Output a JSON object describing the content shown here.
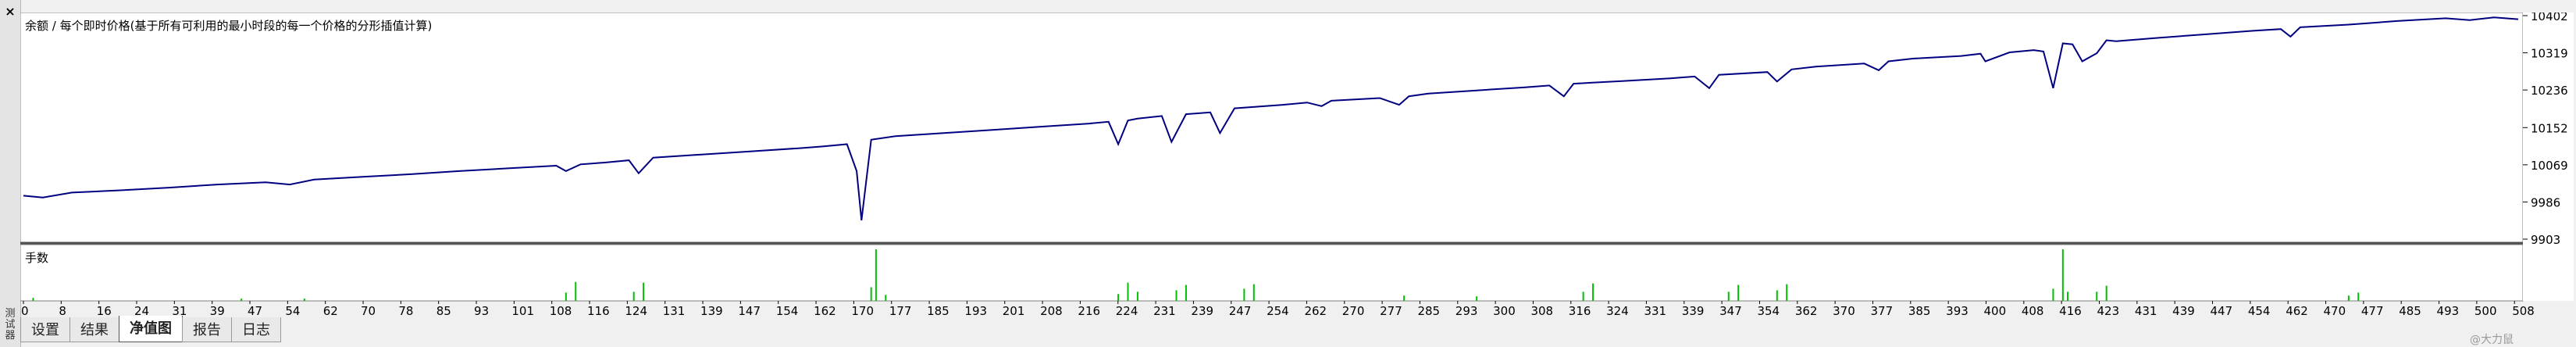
{
  "window": {
    "close_glyph": "×",
    "side_label": "测试器"
  },
  "tabs": [
    {
      "label": "设置",
      "active": false
    },
    {
      "label": "结果",
      "active": false
    },
    {
      "label": "净值图",
      "active": true
    },
    {
      "label": "报告",
      "active": false
    },
    {
      "label": "日志",
      "active": false
    }
  ],
  "watermark": "@大力鼠",
  "chart_data": [
    {
      "type": "line",
      "title": "余额 / 每个即时价格(基于所有可利用的最小时段的每一个价格的分形插值计算)",
      "ylim": [
        9903,
        10402
      ],
      "yticks": [
        "10402",
        "10319",
        "10236",
        "10152",
        "10069",
        "9986",
        "9903"
      ],
      "xlim": [
        0,
        515
      ],
      "series": [
        {
          "color": "#000080",
          "x": [
            0,
            4,
            10,
            20,
            30,
            40,
            50,
            55,
            60,
            70,
            80,
            90,
            100,
            110,
            112,
            115,
            120,
            125,
            127,
            130,
            140,
            150,
            160,
            165,
            170,
            172,
            173,
            175,
            180,
            190,
            200,
            210,
            220,
            224,
            226,
            228,
            230,
            235,
            237,
            240,
            245,
            247,
            250,
            260,
            265,
            268,
            270,
            280,
            284,
            286,
            290,
            300,
            310,
            315,
            318,
            320,
            330,
            340,
            345,
            348,
            350,
            360,
            362,
            365,
            370,
            380,
            383,
            385,
            390,
            400,
            404,
            405,
            410,
            415,
            417,
            419,
            421,
            423,
            425,
            428,
            430,
            432,
            440,
            450,
            460,
            466,
            468,
            470,
            480,
            490,
            500,
            505,
            510,
            515
          ],
          "y": [
            10000,
            9996,
            10007,
            10012,
            10018,
            10025,
            10030,
            10025,
            10036,
            10042,
            10048,
            10055,
            10061,
            10067,
            10055,
            10070,
            10074,
            10079,
            10050,
            10085,
            10092,
            10099,
            10106,
            10110,
            10115,
            10055,
            9945,
            10125,
            10133,
            10140,
            10147,
            10154,
            10161,
            10165,
            10115,
            10168,
            10172,
            10178,
            10120,
            10182,
            10186,
            10140,
            10195,
            10203,
            10208,
            10200,
            10212,
            10218,
            10203,
            10222,
            10228,
            10235,
            10242,
            10246,
            10222,
            10250,
            10256,
            10262,
            10266,
            10240,
            10270,
            10276,
            10255,
            10282,
            10288,
            10295,
            10280,
            10300,
            10306,
            10312,
            10317,
            10300,
            10320,
            10325,
            10322,
            10240,
            10340,
            10338,
            10300,
            10318,
            10347,
            10345,
            10352,
            10360,
            10368,
            10372,
            10355,
            10376,
            10382,
            10390,
            10396,
            10392,
            10398,
            10394
          ]
        }
      ]
    },
    {
      "type": "bar",
      "title": "手数",
      "xlim": [
        0,
        515
      ],
      "xticks": [
        "0",
        "8",
        "16",
        "24",
        "31",
        "39",
        "47",
        "54",
        "62",
        "70",
        "78",
        "85",
        "93",
        "101",
        "108",
        "116",
        "124",
        "131",
        "139",
        "147",
        "154",
        "162",
        "170",
        "177",
        "185",
        "193",
        "201",
        "208",
        "216",
        "224",
        "231",
        "239",
        "247",
        "254",
        "262",
        "270",
        "277",
        "285",
        "293",
        "300",
        "308",
        "316",
        "324",
        "331",
        "339",
        "347",
        "354",
        "362",
        "370",
        "377",
        "385",
        "393",
        "400",
        "408",
        "416",
        "423",
        "431",
        "439",
        "447",
        "454",
        "462",
        "470",
        "477",
        "485",
        "493",
        "500",
        "508"
      ],
      "series": [
        {
          "color": "#00c000",
          "x": [
            2,
            45,
            58,
            112,
            114,
            126,
            128,
            175,
            176,
            178,
            226,
            228,
            230,
            238,
            240,
            252,
            254,
            285,
            300,
            322,
            324,
            352,
            354,
            362,
            364,
            419,
            421,
            422,
            428,
            430,
            480,
            482
          ],
          "values": [
            0.4,
            0.3,
            0.3,
            1.1,
            2.5,
            1.2,
            2.4,
            1.8,
            6.8,
            0.8,
            0.9,
            2.4,
            1.2,
            1.4,
            2.1,
            1.6,
            2.2,
            0.7,
            0.6,
            1.2,
            2.3,
            1.2,
            2.1,
            1.4,
            2.2,
            1.6,
            6.8,
            1.2,
            1.2,
            2.0,
            0.7,
            1.1
          ]
        }
      ]
    }
  ]
}
